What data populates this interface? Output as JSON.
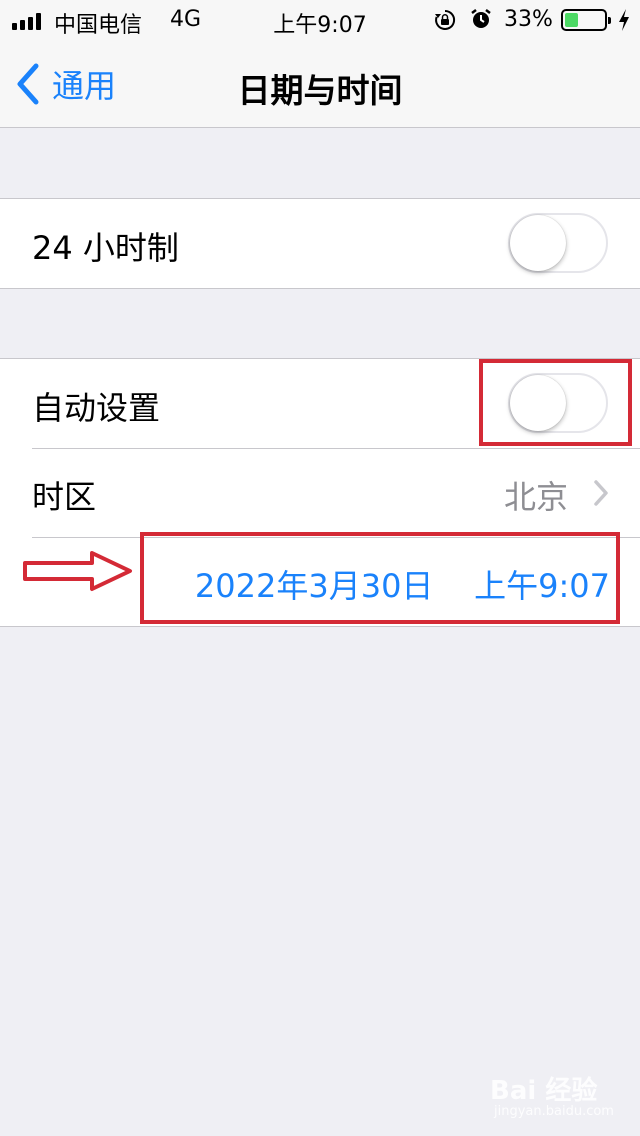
{
  "status_bar": {
    "carrier": "中国电信",
    "network": "4G",
    "time": "上午9:07",
    "battery_percent": "33%",
    "battery_level": 0.33,
    "battery_color": "#4cd964",
    "icons": [
      "signal-icon",
      "orientation-lock-icon",
      "alarm-icon",
      "battery-icon",
      "charging-bolt-icon"
    ]
  },
  "nav": {
    "back_label": "通用",
    "title": "日期与时间",
    "accent_color": "#1a82fb"
  },
  "settings": {
    "hour24": {
      "label": "24 小时制",
      "on": false
    },
    "auto_set": {
      "label": "自动设置",
      "on": false
    },
    "timezone": {
      "label": "时区",
      "value": "北京"
    },
    "datetime": {
      "date": "2022年3月30日",
      "time": "上午9:07"
    }
  },
  "annotations": {
    "highlight_color": "#d42a36"
  },
  "watermark": {
    "main": "Bai 经验",
    "sub": "jingyan.baidu.com"
  }
}
